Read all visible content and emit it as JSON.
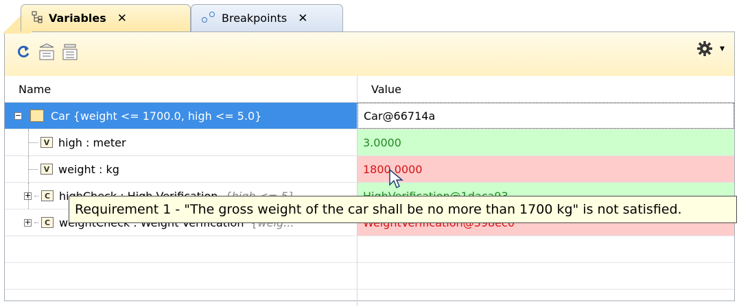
{
  "tabs": [
    {
      "label": "Variables",
      "icon": "variables-icon",
      "active": true
    },
    {
      "label": "Breakpoints",
      "icon": "breakpoints-icon",
      "active": false
    }
  ],
  "close_glyph": "✕",
  "toolbar": {
    "buttons": [
      {
        "icon": "refresh-icon"
      },
      {
        "icon": "expand-all-icon"
      },
      {
        "icon": "collapse-all-icon"
      }
    ],
    "options_icon": "gear-icon",
    "options_arrow": "▾"
  },
  "columns": {
    "name": "Name",
    "value": "Value"
  },
  "rows": [
    {
      "name": "Car {weight <= 1700.0, high <= 5.0}",
      "value": "Car@66714a",
      "state": "selected"
    },
    {
      "name": "high : meter",
      "value": "3.0000",
      "state": "ok",
      "icon_letter": "V"
    },
    {
      "name": "weight : kg",
      "value": "1800.0000",
      "state": "fail",
      "icon_letter": "V"
    },
    {
      "name": "highCheck : High Verification",
      "constraint": "{high <= 5}",
      "value": "HighVerification@1daca93",
      "state": "ok"
    },
    {
      "name": "weightCheck : Weight Verification",
      "constraint": "{weig...",
      "value": "WeightVerification@398ec0",
      "state": "fail"
    }
  ],
  "tooltip": "Requirement 1 - \"The gross weight of the car shall be no more than 1700 kg\" is not satisfied.",
  "colors": {
    "ok_bg": "#ccffcc",
    "ok_text": "#218a21",
    "fail_bg": "#ffcccc",
    "fail_text": "#d41313",
    "selection": "#3d8ee6"
  }
}
